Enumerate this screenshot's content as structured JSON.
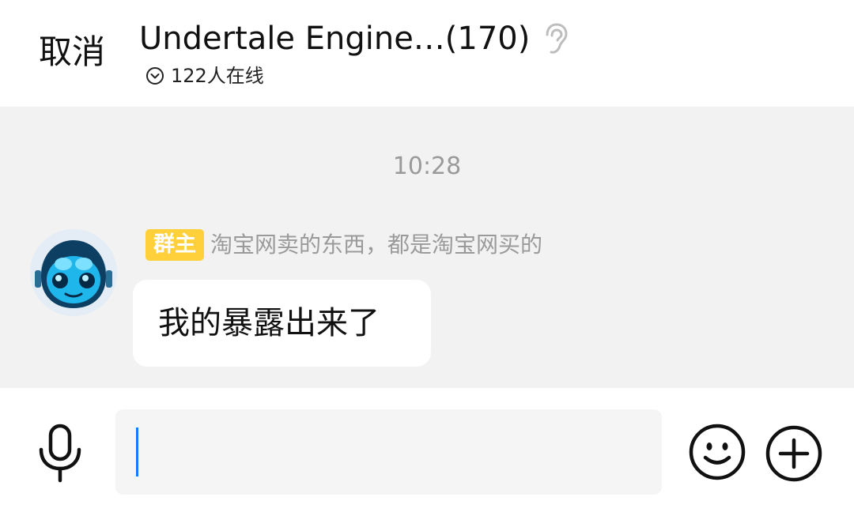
{
  "header": {
    "cancel_label": "取消",
    "group_title": "Undertale Engine…(170)",
    "online_status": "122人在线",
    "icons": {
      "listen": "ear-icon",
      "expand": "chevron-down-circle-icon"
    }
  },
  "chat": {
    "timestamp": "10:28",
    "messages": [
      {
        "role_badge": "群主",
        "sender": "淘宝网卖的东西，都是淘宝网买的",
        "text": "我的暴露出来了",
        "avatar": "blue-robot-avatar"
      }
    ]
  },
  "input_bar": {
    "value": "",
    "placeholder": "",
    "icons": {
      "voice": "microphone-icon",
      "emoji": "smiley-icon",
      "more": "plus-circle-icon"
    }
  },
  "colors": {
    "badge": "#ffd03a",
    "caret": "#1677ff",
    "chat_background": "#f2f2f2",
    "secondary_text": "#9a9a9a"
  }
}
